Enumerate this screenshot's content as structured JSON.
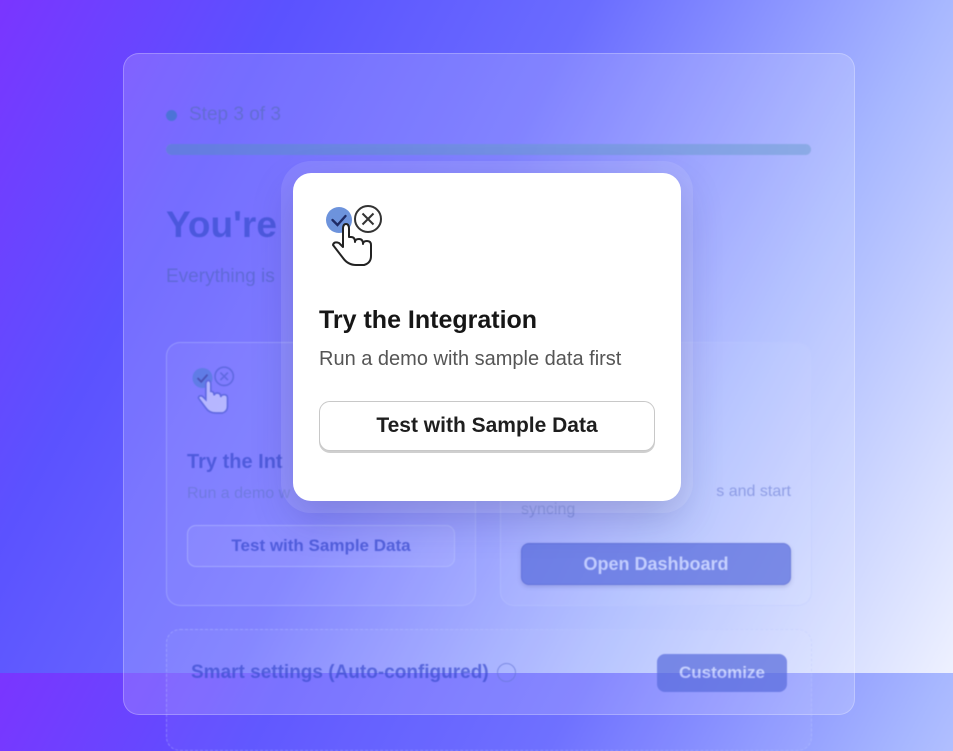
{
  "step": {
    "label": "Step 3 of 3",
    "progress_fraction": 1.0
  },
  "hero": {
    "title_visible": "You're",
    "subtitle_visible": "Everything is"
  },
  "options": [
    {
      "title_visible": "Try the Int",
      "desc_visible": "Run a demo w",
      "button_label": "Test with Sample Data"
    },
    {
      "desc_visible_a": "s and start",
      "desc_visible_b": "syncing",
      "button_label": "Open Dashboard"
    }
  ],
  "smart_settings": {
    "title": "Smart settings (Auto-configured)",
    "button_label": "Customize"
  },
  "popover": {
    "icon": "check-x-toggle-with-hand-cursor-icon",
    "title": "Try the Integration",
    "description": "Run a demo with sample data first",
    "button_label": "Test with Sample Data"
  },
  "colors": {
    "accent": "#5a6ddd",
    "dot": "#3b78c9",
    "popover_bg": "#ffffff"
  }
}
